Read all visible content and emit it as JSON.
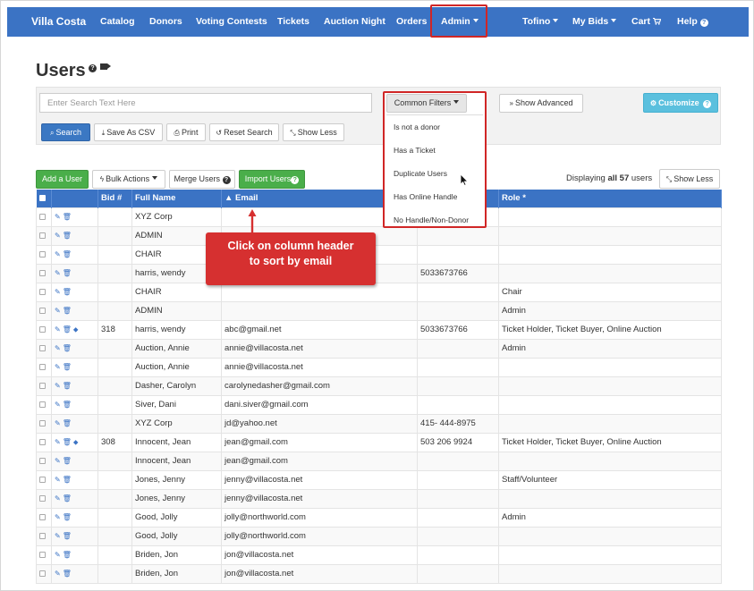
{
  "nav": {
    "brand": "Villa Costa",
    "items": [
      "Catalog",
      "Donors",
      "Voting Contests",
      "Tickets",
      "Auction Night",
      "Orders"
    ],
    "admin": "Admin",
    "right_items": [
      "Tofino",
      "My Bids"
    ],
    "cart": "Cart",
    "help": "Help"
  },
  "page": {
    "title": "Users"
  },
  "search": {
    "placeholder": "Enter Search Text Here",
    "common_filters": "Common Filters",
    "show_advanced": "Show Advanced",
    "customize": "Customize",
    "buttons": {
      "search": "Search",
      "save_csv": "Save As CSV",
      "print": "Print",
      "reset": "Reset Search",
      "show_less": "Show Less"
    },
    "filter_options": [
      "Is not a donor",
      "Has a Ticket",
      "Duplicate Users",
      "Has Online Handle",
      "No Handle/Non-Donor"
    ]
  },
  "actions": {
    "add_user": "Add a User",
    "bulk_actions": "Bulk Actions",
    "merge_users": "Merge Users",
    "import_users": "Import Users",
    "display_prefix": "Displaying",
    "display_all": "all",
    "display_count": "57",
    "display_suffix": "users",
    "show_less": "Show Less"
  },
  "table": {
    "columns": {
      "bid": "Bid #",
      "name": "Full Name",
      "email": "▲ Email",
      "role": "Role *"
    },
    "rows": [
      {
        "bid": "",
        "name": "XYZ Corp",
        "email": "",
        "phone": "",
        "role": "",
        "tag": false
      },
      {
        "bid": "",
        "name": "ADMIN",
        "email": "",
        "phone": "",
        "role": "",
        "tag": false
      },
      {
        "bid": "",
        "name": "CHAIR",
        "email": "",
        "phone": "",
        "role": "",
        "tag": false
      },
      {
        "bid": "",
        "name": "harris, wendy",
        "email": "",
        "phone": "5033673766",
        "role": "",
        "tag": false
      },
      {
        "bid": "",
        "name": "CHAIR",
        "email": "",
        "phone": "",
        "role": "Chair",
        "tag": false
      },
      {
        "bid": "",
        "name": "ADMIN",
        "email": "",
        "phone": "",
        "role": "Admin",
        "tag": false
      },
      {
        "bid": "318",
        "name": "harris, wendy",
        "email": "abc@gmail.net",
        "phone": "5033673766",
        "role": "Ticket Holder, Ticket Buyer, Online Auction",
        "tag": true
      },
      {
        "bid": "",
        "name": "Auction, Annie",
        "email": "annie@villacosta.net",
        "phone": "",
        "role": "Admin",
        "tag": false
      },
      {
        "bid": "",
        "name": "Auction, Annie",
        "email": "annie@villacosta.net",
        "phone": "",
        "role": "",
        "tag": false
      },
      {
        "bid": "",
        "name": "Dasher, Carolyn",
        "email": "carolynedasher@gmail.com",
        "phone": "",
        "role": "",
        "tag": false
      },
      {
        "bid": "",
        "name": "Siver, Dani",
        "email": "dani.siver@gmail.com",
        "phone": "",
        "role": "",
        "tag": false
      },
      {
        "bid": "",
        "name": "XYZ Corp",
        "email": "jd@yahoo.net",
        "phone": "415- 444-8975",
        "role": "",
        "tag": false
      },
      {
        "bid": "308",
        "name": "Innocent, Jean",
        "email": "jean@gmail.com",
        "phone": "503 206 9924",
        "role": "Ticket Holder, Ticket Buyer, Online Auction",
        "tag": true
      },
      {
        "bid": "",
        "name": "Innocent, Jean",
        "email": "jean@gmail.com",
        "phone": "",
        "role": "",
        "tag": false
      },
      {
        "bid": "",
        "name": "Jones, Jenny",
        "email": "jenny@villacosta.net",
        "phone": "",
        "role": "Staff/Volunteer",
        "tag": false
      },
      {
        "bid": "",
        "name": "Jones, Jenny",
        "email": "jenny@villacosta.net",
        "phone": "",
        "role": "",
        "tag": false
      },
      {
        "bid": "",
        "name": "Good, Jolly",
        "email": "jolly@northworld.com",
        "phone": "",
        "role": "Admin",
        "tag": false
      },
      {
        "bid": "",
        "name": "Good, Jolly",
        "email": "jolly@northworld.com",
        "phone": "",
        "role": "",
        "tag": false
      },
      {
        "bid": "",
        "name": "Briden, Jon",
        "email": "jon@villacosta.net",
        "phone": "",
        "role": "",
        "tag": false
      },
      {
        "bid": "",
        "name": "Briden, Jon",
        "email": "jon@villacosta.net",
        "phone": "",
        "role": "",
        "tag": false
      }
    ]
  },
  "callout": {
    "line1": "Click on column header",
    "line2": "to sort by email"
  },
  "colors": {
    "navbar": "#3b73c4",
    "primary": "#3b78c3",
    "success": "#4aae4a",
    "info": "#5bc0de",
    "highlight": "#d02626",
    "callout": "#d63030"
  },
  "icons": [
    "question-icon",
    "video-camera-icon",
    "search-icon",
    "download-icon",
    "print-icon",
    "reset-icon",
    "expand-icon",
    "gear-icon",
    "bolt-icon",
    "cart-icon",
    "edit-icon",
    "trash-icon",
    "tag-icon",
    "mouse-cursor-icon"
  ]
}
